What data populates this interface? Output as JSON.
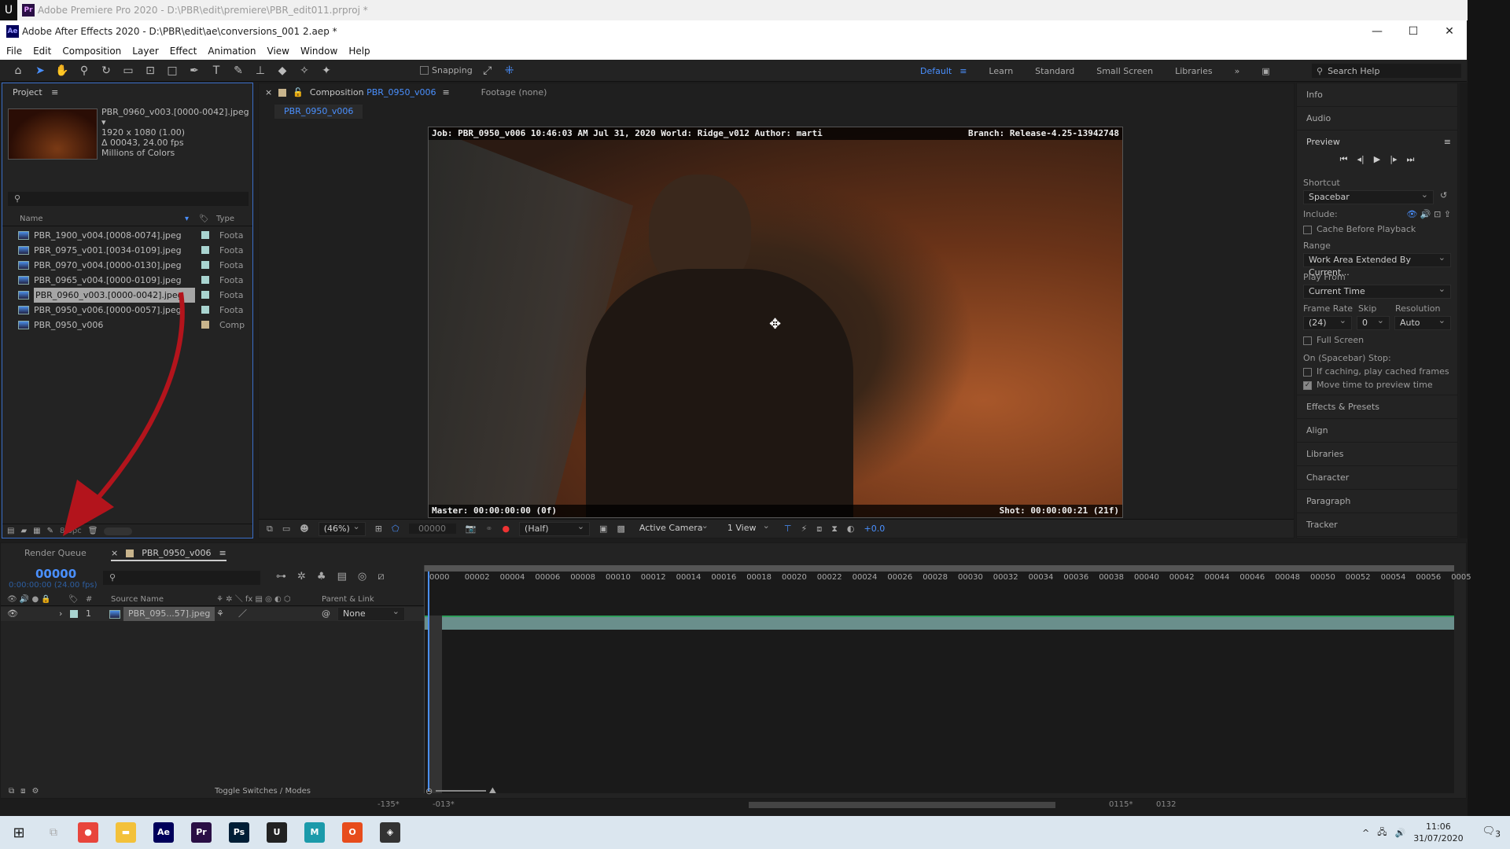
{
  "premiere": {
    "title": "Adobe Premiere Pro 2020 - D:\\PBR\\edit\\premiere\\PBR_edit011.prproj *",
    "logo": "Pr"
  },
  "window": {
    "title": "Adobe After Effects 2020 - D:\\PBR\\edit\\ae\\conversions_001 2.aep *",
    "logo": "Ae",
    "minimize": "—",
    "maximize": "☐",
    "close": "✕"
  },
  "menu": [
    "File",
    "Edit",
    "Composition",
    "Layer",
    "Effect",
    "Animation",
    "View",
    "Window",
    "Help"
  ],
  "toolbar": {
    "snapping": "Snapping",
    "workspaces": [
      "Default",
      "Learn",
      "Standard",
      "Small Screen",
      "Libraries"
    ],
    "active_workspace": "Default",
    "search_placeholder": "Search Help"
  },
  "project": {
    "title": "Project",
    "selected": {
      "name": "PBR_0960_v003.[0000-0042].jpeg",
      "size": "1920 x 1080 (1.00)",
      "duration": "Δ 00043, 24.00 fps",
      "colors": "Millions of Colors"
    },
    "columns": {
      "name": "Name",
      "type": "Type"
    },
    "items": [
      {
        "name": "PBR_1900_v004.[0008-0074].jpeg",
        "type": "Foota",
        "color": "#a9d4d0"
      },
      {
        "name": "PBR_0975_v001.[0034-0109].jpeg",
        "type": "Foota",
        "color": "#a9d4d0"
      },
      {
        "name": "PBR_0970_v004.[0000-0130].jpeg",
        "type": "Foota",
        "color": "#a9d4d0"
      },
      {
        "name": "PBR_0965_v004.[0000-0109].jpeg",
        "type": "Foota",
        "color": "#a9d4d0"
      },
      {
        "name": "PBR_0960_v003.[0000-0042].jpeg",
        "type": "Foota",
        "color": "#a9d4d0",
        "selected": true
      },
      {
        "name": "PBR_0950_v006.[0000-0057].jpeg",
        "type": "Foota",
        "color": "#a9d4d0"
      },
      {
        "name": "PBR_0950_v006",
        "type": "Comp",
        "color": "#c8b48c"
      }
    ],
    "bpc": "8 bpc"
  },
  "comp": {
    "tab_prefix": "Composition",
    "tab_name": "PBR_0950_v006",
    "footage_tab": "Footage (none)",
    "sub_tab": "PBR_0950_v006",
    "overlay_top_left": "Job: PBR_0950_v006 10:46:03 AM Jul 31, 2020 World: Ridge_v012 Author: marti",
    "overlay_top_right": "Branch: Release-4.25-13942748",
    "overlay_bottom_left": "Master: 00:00:00:00 (0f)",
    "overlay_bottom_right": "Shot:  00:00:00:21 (21f)",
    "zoom": "(46%)",
    "timecode": "00000",
    "resolution": "(Half)",
    "camera": "Active Camera",
    "views": "1 View",
    "exposure": "+0.0"
  },
  "right_panel": {
    "info": "Info",
    "audio": "Audio",
    "preview": "Preview",
    "shortcut_label": "Shortcut",
    "shortcut": "Spacebar",
    "include_label": "Include:",
    "cache_before": "Cache Before Playback",
    "range_label": "Range",
    "range": "Work Area Extended By Current...",
    "play_from_label": "Play From",
    "play_from": "Current Time",
    "frame_rate_label": "Frame Rate",
    "skip_label": "Skip",
    "resolution_label": "Resolution",
    "frame_rate": "(24)",
    "skip": "0",
    "resolution": "Auto",
    "full_screen": "Full Screen",
    "stop_label": "On (Spacebar) Stop:",
    "if_caching": "If caching, play cached frames",
    "move_time": "Move time to preview time",
    "move_time_checked": true,
    "sections": [
      "Effects & Presets",
      "Align",
      "Libraries",
      "Character",
      "Paragraph",
      "Tracker"
    ]
  },
  "timeline": {
    "render_queue": "Render Queue",
    "tab": "PBR_0950_v006",
    "tab_color": "#c8b48c",
    "current_frame": "00000",
    "current_time": "0:00:00:00 (24.00 fps)",
    "col_source": "Source Name",
    "col_parent": "Parent & Link",
    "layer_number": "1",
    "layer_name": "PBR_095...57].jpeg",
    "layer_color": "#a9d4d0",
    "parent": "None",
    "toggle": "Toggle Switches / Modes",
    "ruler": [
      "0000",
      "00002",
      "00004",
      "00006",
      "00008",
      "00010",
      "00012",
      "00014",
      "00016",
      "00018",
      "00020",
      "00022",
      "00024",
      "00026",
      "00028",
      "00030",
      "00032",
      "00034",
      "00036",
      "00038",
      "00040",
      "00042",
      "00044",
      "00046",
      "00048",
      "00050",
      "00052",
      "00054",
      "00056",
      "0005"
    ],
    "behind": [
      "-135*",
      "-013*",
      "0115*",
      "0132"
    ]
  },
  "taskbar": {
    "apps": [
      {
        "n": "Chrome",
        "c": "#e8453c",
        "t": "●"
      },
      {
        "n": "Explorer",
        "c": "#f3c13a",
        "t": "▬"
      },
      {
        "n": "Ae",
        "c": "#00005b",
        "t": "Ae"
      },
      {
        "n": "Pr",
        "c": "#2a0f45",
        "t": "Pr"
      },
      {
        "n": "Ps",
        "c": "#001e36",
        "t": "Ps"
      },
      {
        "n": "Unreal",
        "c": "#222",
        "t": "U"
      },
      {
        "n": "Maya",
        "c": "#1b9aaa",
        "t": "M"
      },
      {
        "n": "Office",
        "c": "#e74c1c",
        "t": "O"
      },
      {
        "n": "Unity",
        "c": "#333",
        "t": "◈"
      }
    ],
    "time": "11:06",
    "date": "31/07/2020",
    "notifications": "3"
  }
}
